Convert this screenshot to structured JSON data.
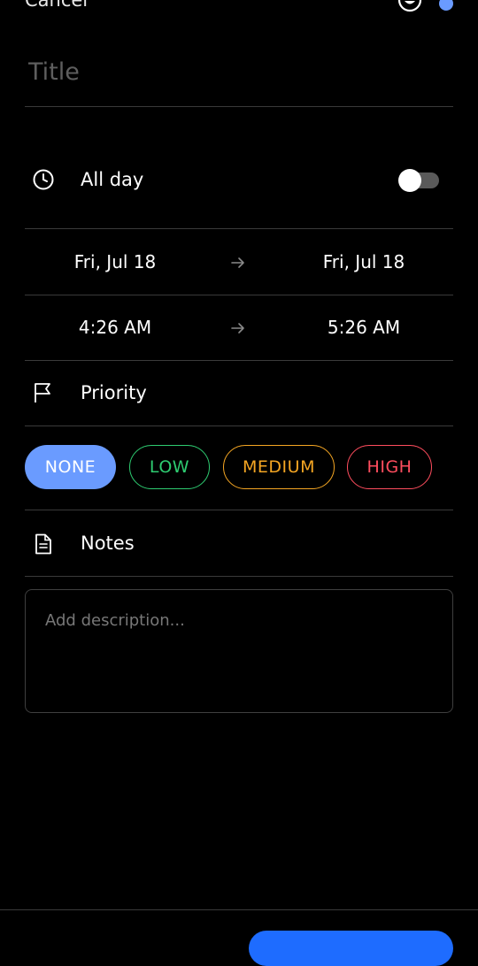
{
  "header": {
    "cancel_label": "Cancel"
  },
  "title": {
    "placeholder": "Title"
  },
  "all_day": {
    "label": "All day",
    "enabled": false
  },
  "start": {
    "date": "Fri, Jul 18",
    "time": "4:26 AM"
  },
  "end": {
    "date": "Fri, Jul 18",
    "time": "5:26 AM"
  },
  "priority": {
    "label": "Priority",
    "selected": "NONE",
    "options": [
      "NONE",
      "LOW",
      "MEDIUM",
      "HIGH"
    ],
    "colors": {
      "NONE": "#6a9bff",
      "LOW": "#2ecc71",
      "MEDIUM": "#f5a623",
      "HIGH": "#ff4d5e"
    }
  },
  "notes": {
    "label": "Notes",
    "placeholder": "Add description..."
  },
  "icons": [
    "clock-icon",
    "flag-icon",
    "document-icon",
    "arrow-right-icon",
    "face-icon"
  ]
}
